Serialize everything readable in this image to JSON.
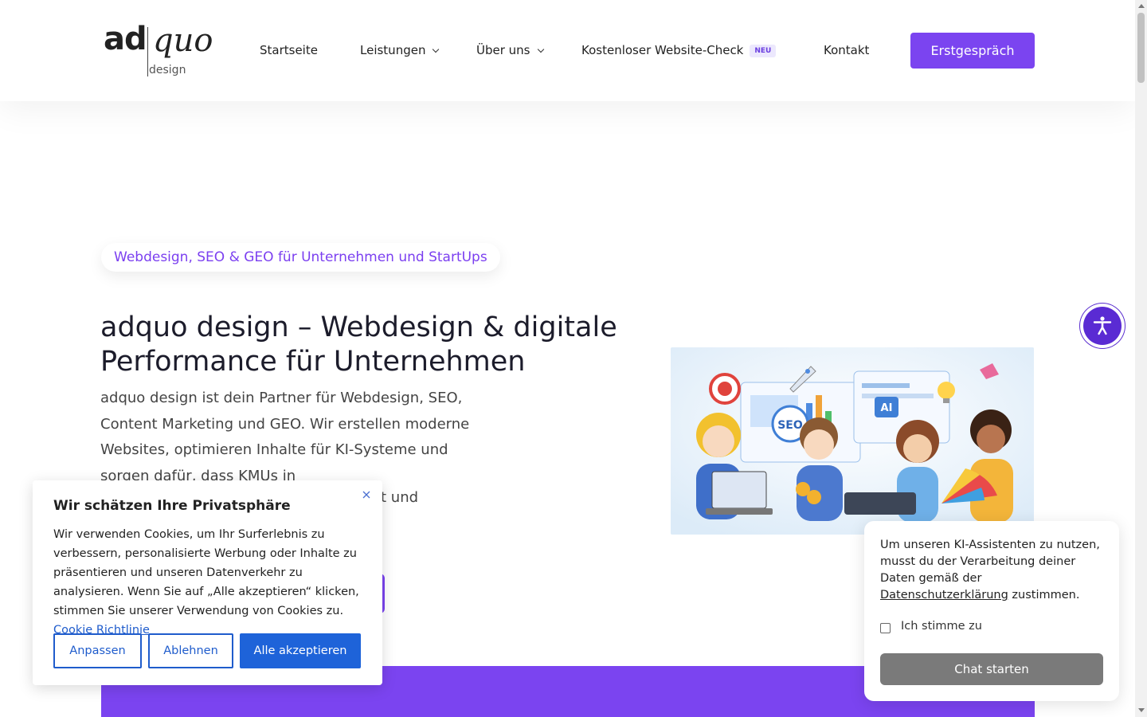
{
  "brand": {
    "logo_part1": "ad",
    "logo_part2": "quo",
    "logo_sub": "design"
  },
  "nav": {
    "items": [
      {
        "label": "Startseite"
      },
      {
        "label": "Leistungen"
      },
      {
        "label": "Über uns"
      },
      {
        "label": "Kostenloser Website-Check",
        "badge": "NEU"
      },
      {
        "label": "Kontakt"
      }
    ],
    "cta_label": "Erstgespräch"
  },
  "hero": {
    "tagline": "Webdesign, SEO & GEO für Unternehmen und StartUps",
    "title": "adquo design – Webdesign & digitale Performance für Unternehmen",
    "text": "adquo design ist dein Partner für Webdesign, SEO, Content Marketing und GEO. Wir erstellen moderne Websites, optimieren Inhalte für KI-Systeme und sorgen dafür, dass KMUs in",
    "text_tail": "t und",
    "illustration_labels": {
      "seo": "SEO",
      "ai": "AI"
    }
  },
  "cookie": {
    "title": "Wir schätzen Ihre Privatsphäre",
    "text": "Wir verwenden Cookies, um Ihr Surferlebnis zu verbessern, personalisierte Werbung oder Inhalte zu präsentieren und unseren Datenverkehr zu analysieren. Wenn Sie auf „Alle akzeptieren“ klicken, stimmen Sie unserer Verwendung von Cookies zu.",
    "link": "Cookie Richtlinie",
    "btn_customize": "Anpassen",
    "btn_reject": "Ablehnen",
    "btn_accept": "Alle akzeptieren"
  },
  "chat": {
    "text_before": "Um unseren KI-Assistenten zu nutzen, musst du der Verarbeitung deiner Daten gemäß der",
    "link": "Datenschutzerklärung",
    "text_after": "zustimmen.",
    "checkbox_label": "Ich stimme zu",
    "button": "Chat starten"
  },
  "colors": {
    "accent": "#7b44f0",
    "cookie_blue": "#1e63d9",
    "a11y": "#5a2bd3"
  },
  "icons": {
    "accessibility": "accessibility-icon",
    "close": "close-icon",
    "chevron": "chevron-down-icon"
  }
}
